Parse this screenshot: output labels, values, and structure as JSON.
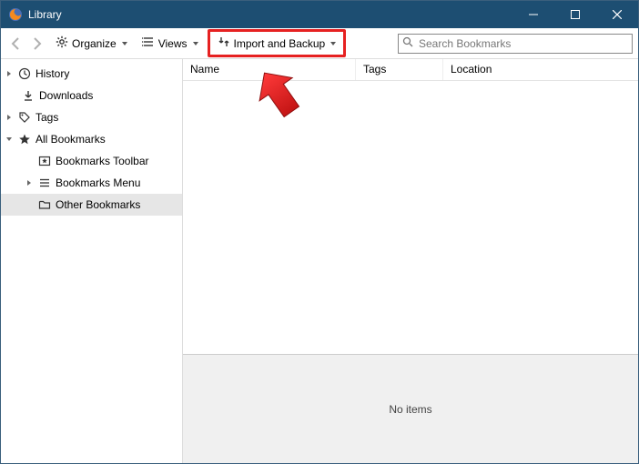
{
  "window": {
    "title": "Library"
  },
  "toolbar": {
    "organize_label": "Organize",
    "views_label": "Views",
    "import_label": "Import and Backup"
  },
  "search": {
    "placeholder": "Search Bookmarks"
  },
  "sidebar": {
    "history": "History",
    "downloads": "Downloads",
    "tags": "Tags",
    "all_bookmarks": "All Bookmarks",
    "bookmarks_toolbar": "Bookmarks Toolbar",
    "bookmarks_menu": "Bookmarks Menu",
    "other_bookmarks": "Other Bookmarks"
  },
  "columns": {
    "name": "Name",
    "tags": "Tags",
    "location": "Location"
  },
  "details": {
    "empty": "No items"
  }
}
